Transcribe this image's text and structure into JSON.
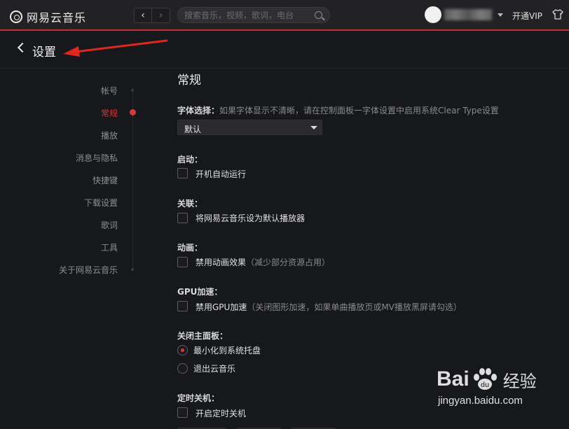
{
  "app": {
    "name": "网易云音乐"
  },
  "nav": {
    "back_glyph": "‹",
    "forward_glyph": "›"
  },
  "search": {
    "placeholder": "搜索音乐，视频，歌词，电台"
  },
  "user": {
    "vip_label": "开通VIP"
  },
  "header": {
    "title": "设置"
  },
  "sidebar": {
    "items": [
      {
        "label": "帐号",
        "active": false
      },
      {
        "label": "常规",
        "active": true
      },
      {
        "label": "播放",
        "active": false
      },
      {
        "label": "消息与隐私",
        "active": false
      },
      {
        "label": "快捷键",
        "active": false
      },
      {
        "label": "下载设置",
        "active": false
      },
      {
        "label": "歌词",
        "active": false
      },
      {
        "label": "工具",
        "active": false
      },
      {
        "label": "关于网易云音乐",
        "active": false
      }
    ]
  },
  "general": {
    "title": "常规",
    "font": {
      "label": "字体选择：",
      "hint": "如果字体显示不清晰，请在控制面板一字体设置中启用系统Clear Type设置",
      "selected": "默认"
    },
    "startup": {
      "label": "启动：",
      "option": "开机自动运行",
      "checked": false
    },
    "association": {
      "label": "关联：",
      "option": "将网易云音乐设为默认播放器",
      "checked": false
    },
    "animation": {
      "label": "动画：",
      "option": "禁用动画效果",
      "note": "（减少部分资源占用）",
      "checked": false
    },
    "gpu": {
      "label": "GPU加速：",
      "option": "禁用GPU加速",
      "note": "（关闭图形加速，如果单曲播放页或MV播放黑屏请勾选）",
      "checked": false
    },
    "close_panel": {
      "label": "关闭主面板：",
      "options": [
        {
          "label": "最小化到系统托盘",
          "checked": true
        },
        {
          "label": "退出云音乐",
          "checked": false
        }
      ]
    },
    "timer": {
      "label": "定时关机：",
      "option": "开启定时关机",
      "checked": false
    }
  },
  "watermark": {
    "brand": "Bai",
    "brand_suffix": "经验",
    "url": "jingyan.baidu.com"
  },
  "colors": {
    "accent": "#d33a3a",
    "topbar": "#222225",
    "background": "#16181c",
    "annotation_arrow": "#e0261f"
  }
}
